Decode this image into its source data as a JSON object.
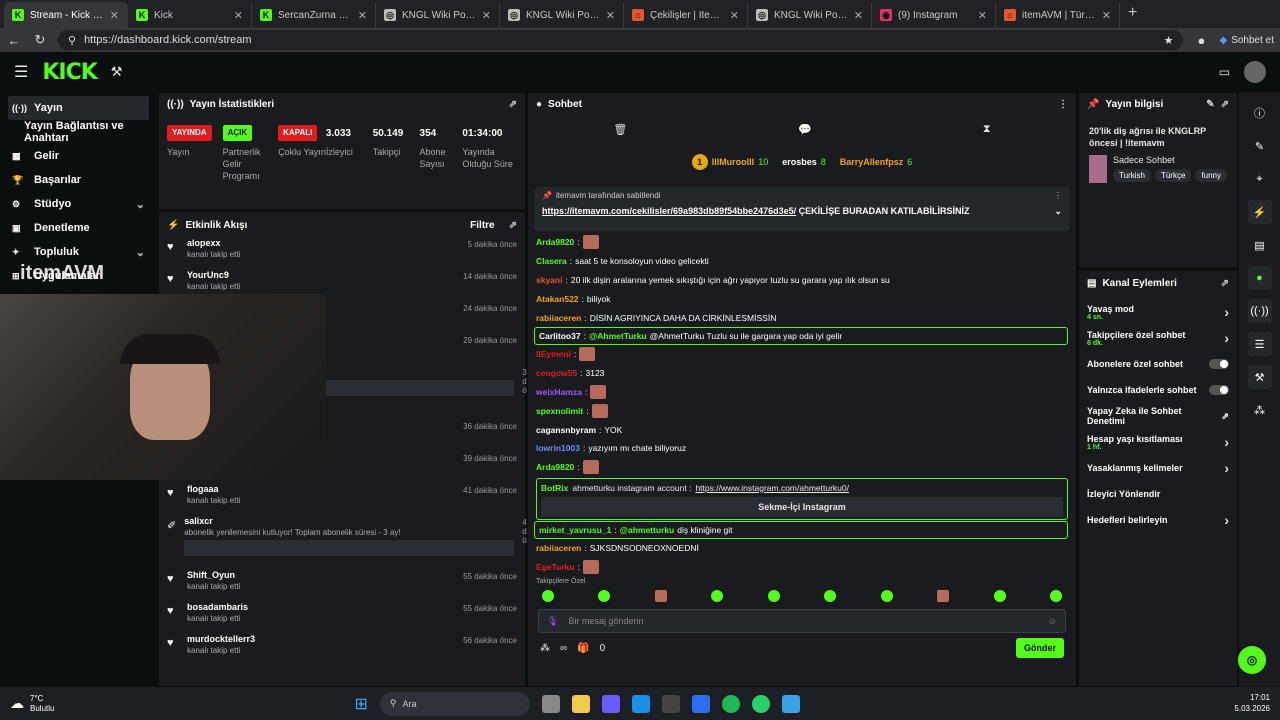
{
  "browser": {
    "tabs": [
      {
        "label": "Stream - Kick Dashboard",
        "fav": "K",
        "color": "#53fc18",
        "active": true
      },
      {
        "label": "Kick",
        "fav": "K",
        "color": "#53fc18"
      },
      {
        "label": "SercanZurna Stream - W",
        "fav": "K",
        "color": "#53fc18"
      },
      {
        "label": "KNGL Wiki Portal",
        "fav": "◎",
        "color": "#bbbbbb"
      },
      {
        "label": "KNGL Wiki Portal",
        "fav": "◎",
        "color": "#bbbbbb"
      },
      {
        "label": "Çekilişler | ItemAVM",
        "fav": "⌂",
        "color": "#e8542a"
      },
      {
        "label": "KNGL Wiki Portal",
        "fav": "◎",
        "color": "#bbbbbb"
      },
      {
        "label": "(9) Instagram",
        "fav": "◉",
        "color": "#e1306c"
      },
      {
        "label": "itemAVM | Türkiye'nin #",
        "fav": "⌂",
        "color": "#e8542a"
      }
    ],
    "url": "https://dashboard.kick.com/stream",
    "side_label": "Sohbet et"
  },
  "nav": {
    "logo": "KICK",
    "items": [
      {
        "label": "Yayın",
        "active": true,
        "icon": "((·))"
      },
      {
        "label": "Yayın Bağlantısı ve Anahtarı",
        "sub": true
      },
      {
        "label": "Gelir",
        "icon": "▦"
      },
      {
        "label": "Başarılar",
        "icon": "🏆"
      },
      {
        "label": "Stüdyo",
        "icon": "⚙",
        "chev": "⌄"
      },
      {
        "label": "Denetleme",
        "icon": "▣"
      },
      {
        "label": "Topluluk",
        "icon": "✦",
        "chev": "⌄"
      },
      {
        "label": "Uygulamalar",
        "icon": "⊞"
      }
    ]
  },
  "stats": {
    "title": "Yayın İstatistikleri",
    "items": [
      {
        "top": "YAYINDA",
        "bg": "#e01c1c",
        "label": "Yayın"
      },
      {
        "top": "AÇIK",
        "bg": "#53fc18",
        "label": "Partnerlik Gelir Programı"
      },
      {
        "top": "KAPALI",
        "bg": "#e01c1c",
        "label": "Çoklu Yayın"
      },
      {
        "value": "3.033",
        "label": "İzleyici"
      },
      {
        "value": "50.149",
        "label": "Takipçi"
      },
      {
        "value": "354",
        "label": "Abone Sayısı"
      },
      {
        "value": "01:34:00",
        "label": "Yayında Olduğu Süre"
      }
    ]
  },
  "activity": {
    "title": "Etkinlik Akışı",
    "filter": "Filtre",
    "items": [
      {
        "name": "alopexx",
        "desc": "kanalı takip etti",
        "time": "5 dakika önce"
      },
      {
        "name": "YourUnc9",
        "desc": "kanalı takip etti",
        "time": "14 dakika önce"
      },
      {
        "name": "",
        "desc": "",
        "time": "24 dakika önce"
      },
      {
        "name": "",
        "desc": "",
        "time": "29 dakika önce"
      },
      {
        "name": "",
        "desc": "abonelik süresi - 7 ay!",
        "time": "32 dakika önce",
        "box": true
      },
      {
        "name": "",
        "desc": "",
        "time": "36 dakika önce"
      },
      {
        "name": "",
        "desc": "",
        "time": "39 dakika önce"
      },
      {
        "name": "flogaaa",
        "desc": "kanalı takip etti",
        "time": "41 dakika önce"
      },
      {
        "name": "salixcr",
        "desc": "abonelik yenilemesini kutluyor! Toplam abonelik süresi - 3 ay!",
        "time": "47 dakika önce",
        "box": true
      },
      {
        "name": "Shift_Oyun",
        "desc": "kanalı takip etti",
        "time": "55 dakika önce"
      },
      {
        "name": "bosadambaris",
        "desc": "kanalı takip etti",
        "time": "55 dakika önce"
      },
      {
        "name": "murdocktellerr3",
        "desc": "kanalı takip etti",
        "time": "56 dakika önce"
      }
    ],
    "watermark": "itemAVM"
  },
  "chat": {
    "title": "Sohbet",
    "leaders": [
      {
        "rank": "1",
        "name": "IlIMurooIII",
        "count": "10"
      },
      {
        "name": "erosbes",
        "count": "8"
      },
      {
        "name": "BarryAllenfpsz",
        "count": "6"
      }
    ],
    "pinned_by": "itemavm tarafından sabitlendi",
    "pinned_link": "https://itemavm.com/cekilisler/69a983db89f54bbe2476d3e5/",
    "pinned_text": "ÇEKİLİŞE BURADAN KATILABİLİRSİNİZ",
    "messages": [
      {
        "user": "Arda9820",
        "color": "#53fc18",
        "text": "",
        "emote": true
      },
      {
        "user": "Clasera",
        "color": "#53fc18",
        "text": "saat 5 te konsoloyun video gelicekti"
      },
      {
        "user": "skyani",
        "color": "#e8542a",
        "text": "20 ilk dişin aralarına yemek sıkıştığı için ağrı yapıyor tuzlu su garara yap ılık olsun su"
      },
      {
        "user": "Atakan522",
        "color": "#f7a21b",
        "text": "biliyok"
      },
      {
        "user": "rabiiaceren",
        "color": "#f7a21b",
        "text": "DİSİN AGRIYINCA DAHA DA CİRKİNLESMİSSİN"
      },
      {
        "user": "Carlitoo37",
        "color": "#ffffff",
        "text": "@AhmetTurku Tuzlu su ile gargara yap oda iyi gelir",
        "hl": true,
        "mention": "@AhmetTurku"
      },
      {
        "user": "llEymenl",
        "color": "#e01c1c",
        "text": "",
        "emote": true
      },
      {
        "user": "cengow55",
        "color": "#e01c1c",
        "text": "3123"
      },
      {
        "user": "weixHamza",
        "color": "#b04cff",
        "text": "",
        "emote": true
      },
      {
        "user": "spexnolimit",
        "color": "#53fc18",
        "text": "",
        "emote": true
      },
      {
        "user": "cagansnbyram",
        "color": "#ffffff",
        "text": "YOK"
      },
      {
        "user": "lowrin1003",
        "color": "#6b8cff",
        "text": "yazıyım mı chate biliyoruz"
      },
      {
        "user": "Arda9820",
        "color": "#53fc18",
        "text": "",
        "emote": true
      }
    ],
    "bot": {
      "user": "BotRix",
      "text": "ahmetturku instagram account :",
      "link": "https://www.instagram.com/ahmetturku0/",
      "button": "Sekme-İçi Instagram"
    },
    "after": [
      {
        "user": "mirket_yavrusu_1",
        "color": "#53fc18",
        "text": "diş kliniğine git",
        "hl": true,
        "mention": "@ahmetturku"
      },
      {
        "user": "rabiiaceren",
        "color": "#f7a21b",
        "text": "SJKSDNSODNEOXNOEDNİ"
      },
      {
        "user": "EgeTurku",
        "color": "#e01c1c",
        "text": "",
        "emote": true
      }
    ],
    "followers_only": "Takipçilere Özel",
    "input_placeholder": "Bir mesaj gönderin",
    "points": "∞",
    "gifts": "0",
    "send": "Gönder"
  },
  "info": {
    "title": "Yayın bilgisi",
    "stream_title": "20'lik diş ağrısı ile KNGLRP öncesi | !itemavm",
    "category": "Sadece Sohbet",
    "tags": [
      "Turkish",
      "Türkçe",
      "funny"
    ]
  },
  "actions": {
    "title": "Kanal Eylemleri",
    "items": [
      {
        "label": "Yavaş mod",
        "sub": "4 sn.",
        "type": "chev"
      },
      {
        "label": "Takipçilere özel sohbet",
        "sub": "6 dk.",
        "type": "chev"
      },
      {
        "label": "Abonelere özel sohbet",
        "type": "toggle"
      },
      {
        "label": "Yalnızca ifadelerle sohbet",
        "type": "toggle"
      },
      {
        "label": "Yapay Zeka ile Sohbet Denetimi",
        "type": "ext"
      },
      {
        "label": "Hesap yaşı kısıtlaması",
        "sub": "1 hf.",
        "type": "chev"
      },
      {
        "label": "Yasaklanmış kelimeler",
        "type": "chev"
      },
      {
        "label": "İzleyici Yönlendir",
        "type": "none"
      },
      {
        "label": "Hedefleri belirleyin",
        "type": "chev"
      }
    ]
  },
  "taskbar": {
    "temp": "7°C",
    "weather": "Bulutlu",
    "search": "Ara",
    "time": "17:01",
    "date": "5.03.2026"
  }
}
